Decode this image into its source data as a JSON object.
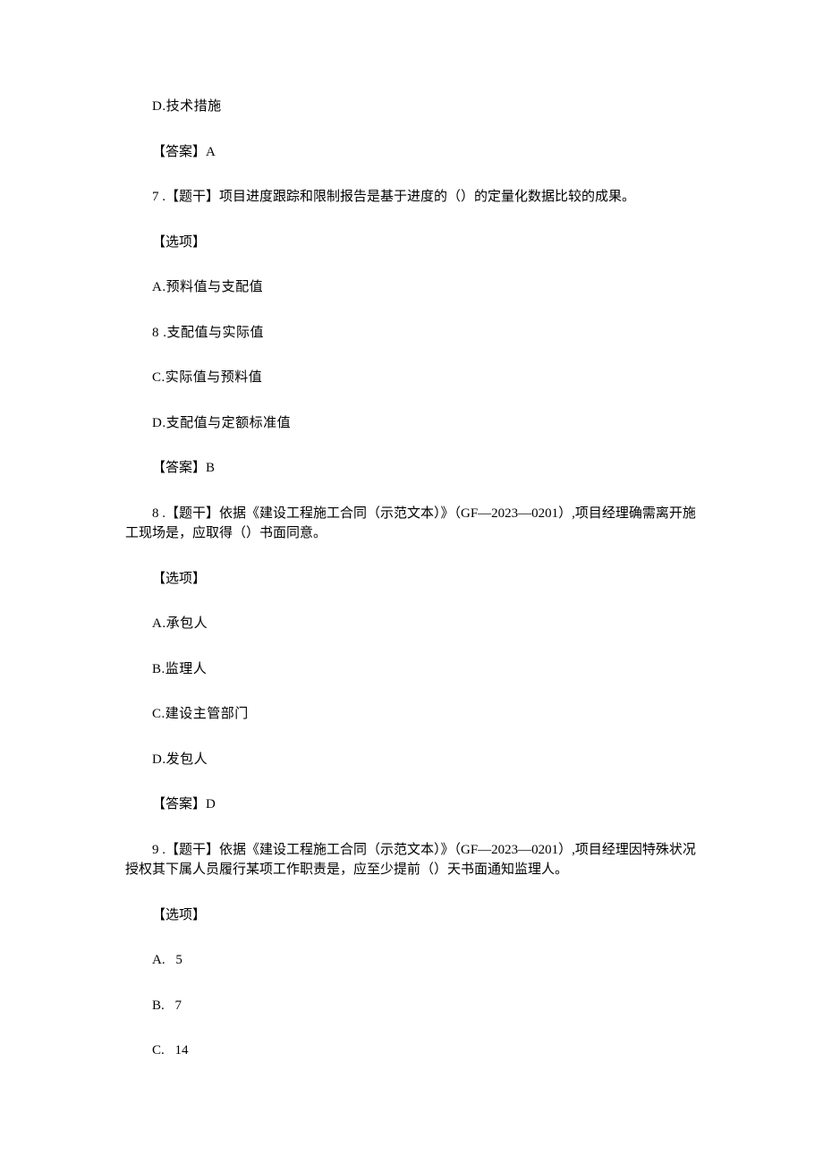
{
  "q6": {
    "option_d": "D.技术措施",
    "answer": "【答案】A"
  },
  "q7": {
    "stem": "7 .【题干】项目进度跟踪和限制报告是基于进度的（）的定量化数据比较的成果。",
    "options_label": "【选项】",
    "option_a": "A.预料值与支配值",
    "option_b": "8 .支配值与实际值",
    "option_c": "C.实际值与预料值",
    "option_d": "D.支配值与定额标准值",
    "answer": "【答案】B"
  },
  "q8": {
    "stem": "8 .【题干】依据《建设工程施工合同（示范文本）》（GF—2023—0201）,项目经理确需离开施工现场是，应取得（）书面同意。",
    "options_label": "【选项】",
    "option_a": "A.承包人",
    "option_b": "B.监理人",
    "option_c": "C.建设主管部门",
    "option_d": "D.发包人",
    "answer": "【答案】D"
  },
  "q9": {
    "stem": "9 .【题干】依据《建设工程施工合同（示范文本）》（GF—2023—0201）,项目经理因特殊状况授权其下属人员履行某项工作职责是，应至少提前（）天书面通知监理人。",
    "options_label": "【选项】",
    "option_a_pre": "A.",
    "option_a_num": "5",
    "option_b_pre": "B.",
    "option_b_num": "7",
    "option_c_pre": "C.",
    "option_c_num": "14"
  }
}
